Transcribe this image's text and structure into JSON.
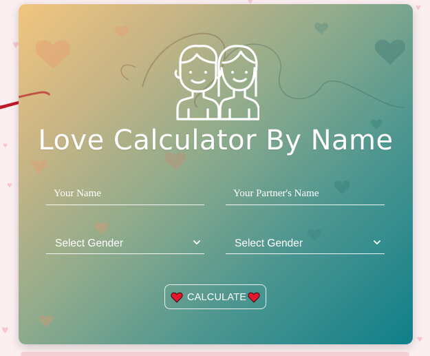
{
  "app": {
    "title": "Love Calculator By Name"
  },
  "form": {
    "your_name_placeholder": "Your Name",
    "partner_name_placeholder": "Your Partner's Name",
    "your_gender_selected": "Select Gender",
    "partner_gender_selected": "Select Gender",
    "calculate_label": "CALCULATE"
  },
  "icons": {
    "hero": "couple-icon",
    "button_left": "red-heart-icon",
    "button_right": "red-heart-icon",
    "dropdown": "chevron-down-icon"
  },
  "colors": {
    "gradient_start": "#f1c57e",
    "gradient_end": "#0f7f8a",
    "text": "#ffffff",
    "heart": "#e3172d"
  }
}
